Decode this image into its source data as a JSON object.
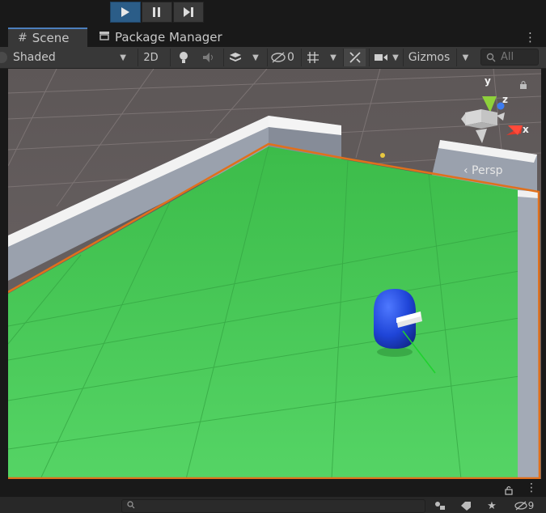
{
  "play_controls": {
    "play_icon": "play-icon",
    "pause_icon": "pause-icon",
    "step_icon": "step-icon",
    "play_active": true
  },
  "tabs": [
    {
      "label": "Scene",
      "icon": "grid-icon",
      "active": true
    },
    {
      "label": "Package Manager",
      "icon": "package-icon",
      "active": false
    }
  ],
  "scene_toolbar": {
    "draw_mode": "Shaded",
    "mode_2d": "2D",
    "hidden_count": "0",
    "gizmos_label": "Gizmos",
    "search_placeholder": "All"
  },
  "viewport": {
    "projection_label": "‹ Persp",
    "axes": {
      "x": "x",
      "y": "y",
      "z": "z"
    },
    "colors": {
      "floor": "#3fc24f",
      "wall_top": "#f2f2f2",
      "wall_side": "#9aa1ad",
      "player": "#1f45d8",
      "selection_outline": "#e0701c",
      "background": "#6a6263"
    }
  },
  "bottom_panel": {
    "search_icon": "search-icon",
    "hidden_count": "9"
  }
}
